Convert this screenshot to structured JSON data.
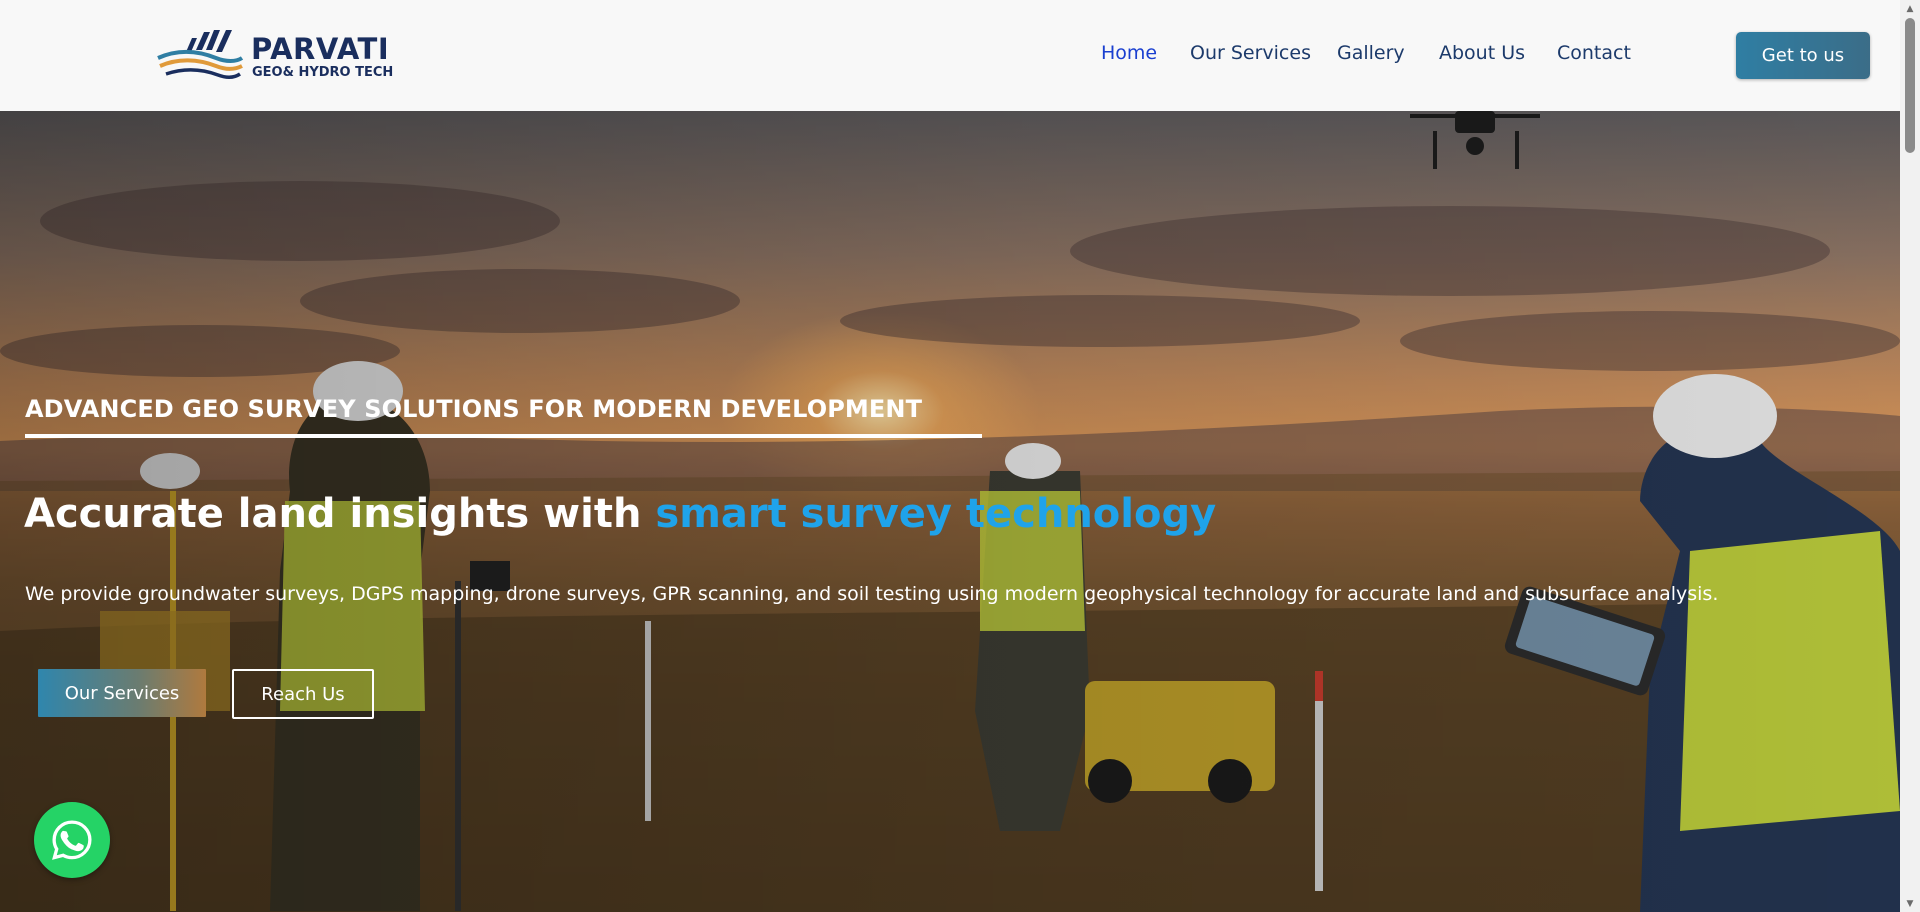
{
  "brand": {
    "name": "PARVATI",
    "subtitle": "GEO& HYDRO TECH",
    "colors": {
      "navy": "#1a2e5e",
      "accent_blue": "#2f7ea3",
      "accent_orange": "#e09a3a"
    }
  },
  "nav": {
    "items": [
      {
        "label": "Home",
        "active": true
      },
      {
        "label": "Our Services",
        "active": false
      },
      {
        "label": "Gallery",
        "active": false
      },
      {
        "label": "About Us",
        "active": false
      },
      {
        "label": "Contact",
        "active": false
      }
    ],
    "cta_label": "Get to us"
  },
  "hero": {
    "tagline": "ADVANCED GEO SURVEY SOLUTIONS FOR MODERN DEVELOPMENT",
    "headline_main": "Accurate land insights with",
    "headline_accent": "smart survey technology",
    "headline_accent_color": "#1fa3ea",
    "description": "We provide groundwater surveys, DGPS mapping, drone surveys, GPR scanning, and soil testing using modern geophysical technology for accurate land and subsurface analysis.",
    "primary_button": "Our Services",
    "secondary_button": "Reach Us"
  },
  "floating": {
    "whatsapp_icon": "whatsapp-icon",
    "color": "#25d366"
  },
  "scrollbar": {
    "up_icon": "arrow-up-icon",
    "down_icon": "arrow-down-icon"
  }
}
